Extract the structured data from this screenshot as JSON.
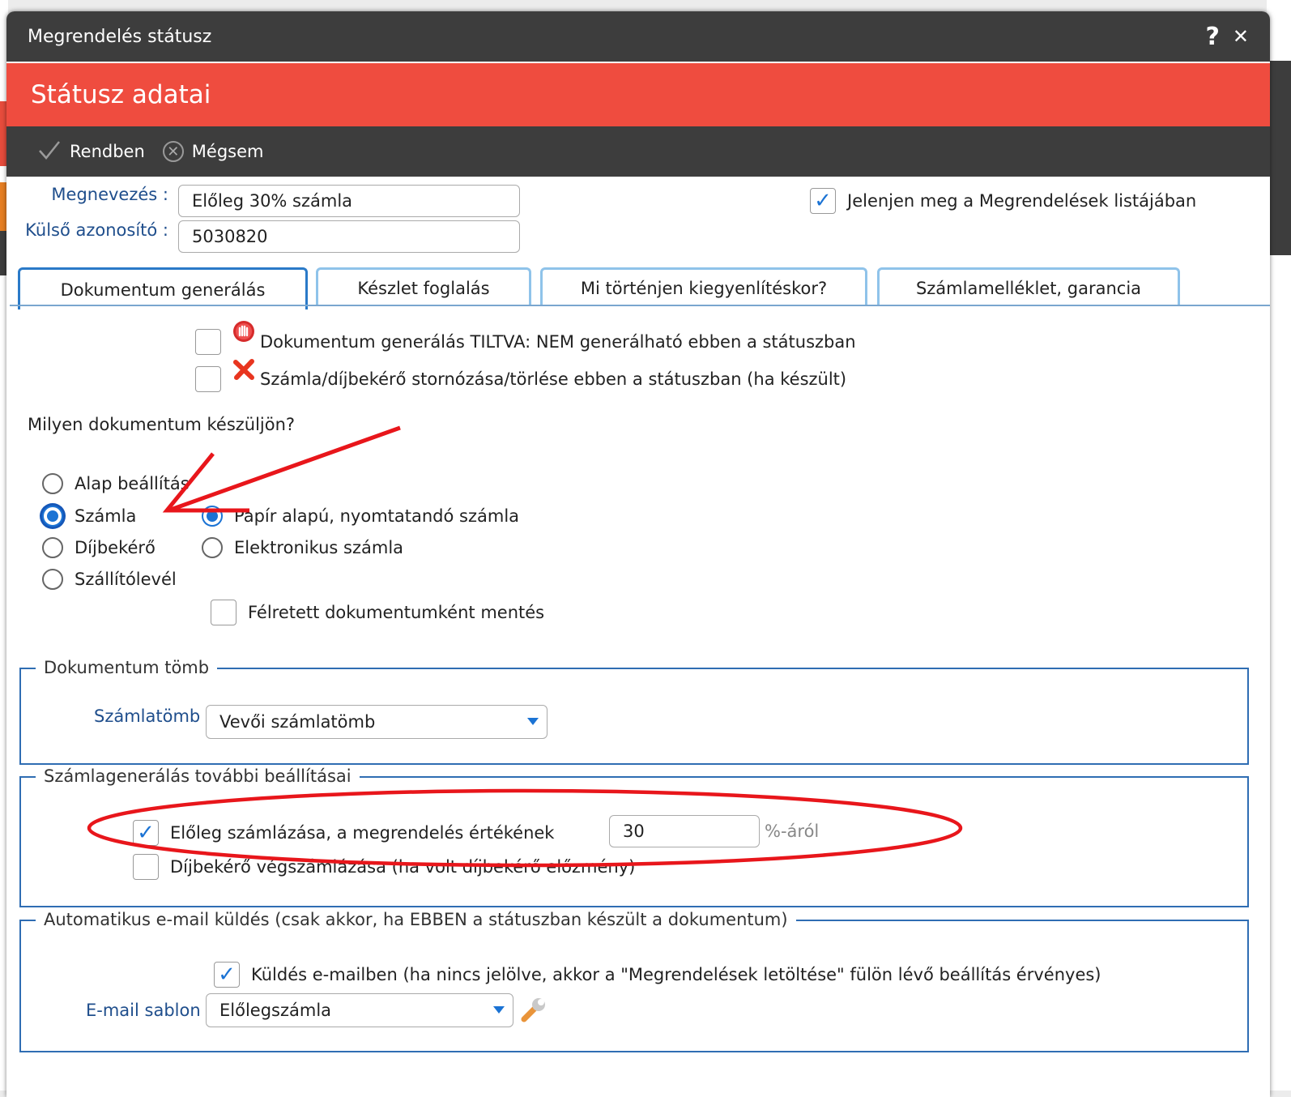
{
  "window": {
    "title": "Megrendelés státusz",
    "help_label": "?",
    "close_label": "✕"
  },
  "header": {
    "title": "Státusz adatai"
  },
  "toolbar": {
    "ok_label": "Rendben",
    "cancel_label": "Mégsem"
  },
  "form": {
    "name_label": "Megnevezés :",
    "name_value": "Előleg 30% számla",
    "ext_id_label": "Külső azonosító :",
    "ext_id_value": "5030820",
    "show_in_list_label": "Jelenjen meg a Megrendelések listájában",
    "show_in_list_checked": true
  },
  "tabs": [
    {
      "label": "Dokumentum generálás",
      "active": true
    },
    {
      "label": "Készlet foglalás",
      "active": false
    },
    {
      "label": "Mi történjen kiegyenlítéskor?",
      "active": false
    },
    {
      "label": "Számlamelléklet, garancia",
      "active": false
    }
  ],
  "doc_tab": {
    "forbid_label": "Dokumentum generálás TILTVA: NEM generálható ebben a státuszban",
    "storno_label": "Számla/díjbekérő stornózása/törlése ebben a státuszban (ha készült)",
    "question": "Milyen dokumentum készüljön?",
    "doc_types": [
      "Alap beállítás",
      "Számla",
      "Díjbekérő",
      "Szállítólevél"
    ],
    "selected_doc_type": "Számla",
    "invoice_kinds": [
      "Papír alapú, nyomtatandó számla",
      "Elektronikus számla"
    ],
    "selected_invoice_kind": "Papír alapú, nyomtatandó számla",
    "save_as_draft_label": "Félretett dokumentumként mentés"
  },
  "doc_block": {
    "legend": "Dokumentum tömb",
    "invoice_block_label": "Számlatömb :",
    "invoice_block_value": "Vevői számlatömb"
  },
  "invoice_settings": {
    "legend": "Számlagenerálás további beállításai",
    "advance_label": "Előleg számlázása, a megrendelés értékének",
    "advance_checked": true,
    "advance_percent": "30",
    "advance_suffix": "%-áról",
    "final_label": "Díjbekérő végszámlázása (ha volt díjbekérő előzmény)",
    "final_checked": false
  },
  "email": {
    "legend": "Automatikus e-mail küldés (csak akkor, ha EBBEN a státuszban készült a dokumentum)",
    "send_label": "Küldés e-mailben (ha nincs jelölve, akkor a \"Megrendelések letöltése\" fülön lévő beállítás érvényes)",
    "send_checked": true,
    "template_label": "E-mail sablon :",
    "template_value": "Előlegszámla"
  },
  "icons": {
    "ok": "checkmark-icon",
    "cancel": "cancel-circle-icon",
    "forbid": "stop-hand-icon",
    "storno": "red-x-icon",
    "wrench": "wrench-icon"
  },
  "colors": {
    "header_red": "#ef4c3f",
    "dark_bar": "#3d3d3d",
    "accent_blue": "#1b73d4",
    "annotation_red": "#e8161b"
  }
}
